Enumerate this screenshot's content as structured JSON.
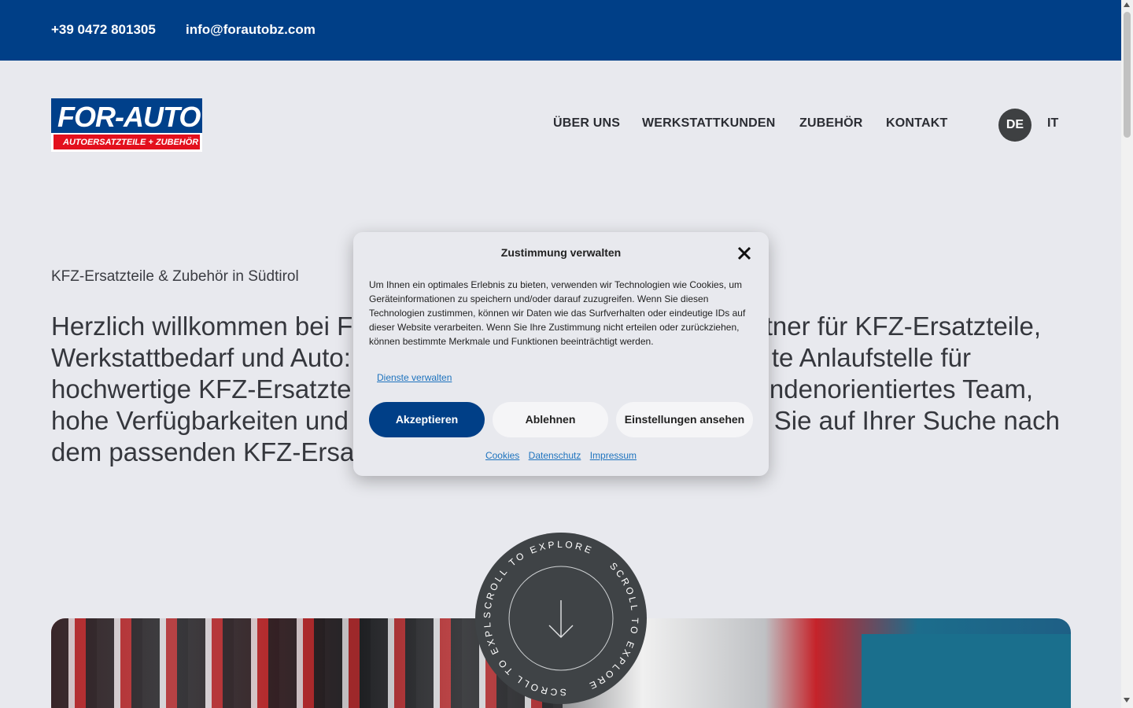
{
  "topbar": {
    "phone": "+39 0472 801305",
    "email": "info@forautobz.com",
    "bg_color": "#003f87"
  },
  "logo": {
    "brand": "FOR-AUTO",
    "tagline": "AUTOERSATZTEILE + ZUBEHÖR"
  },
  "nav": {
    "items": [
      {
        "label": "ÜBER UNS"
      },
      {
        "label": "WERKSTATTKUNDEN"
      },
      {
        "label": "ZUBEHÖR"
      },
      {
        "label": "KONTAKT"
      }
    ],
    "lang_active": "DE",
    "lang_other": "IT"
  },
  "hero": {
    "eyebrow": "KFZ-Ersatzteile & Zubehör in Südtirol",
    "line1_left": "Herzlich willkommen bei F",
    "line1_right": "tner für KFZ-Ersatzteile,",
    "line2_left": "Werkstattbedarf und Auto:",
    "line2_right": "te Anlaufstelle für",
    "line3_left": "hochwertige KFZ-Ersatzte",
    "line3_right": "ndenorientiertes Team,",
    "line4_left": "hohe Verfügbarkeiten und",
    "line4_right": "Sie auf Ihrer Suche nach",
    "line5_left": "dem passenden KFZ-Ersa"
  },
  "scroll_badge": {
    "text": "SCROLL TO EXPLORE",
    "icon": "arrow-down-icon"
  },
  "consent": {
    "title": "Zustimmung verwalten",
    "close_icon": "close-icon",
    "body": "Um Ihnen ein optimales Erlebnis zu bieten, verwenden wir Technologien wie Cookies, um Geräteinformationen zu speichern und/oder darauf zuzugreifen. Wenn Sie diesen Technologien zustimmen, können wir Daten wie das Surfverhalten oder eindeutige IDs auf dieser Website verarbeiten. Wenn Sie Ihre Zustimmung nicht erteilen oder zurückziehen, können bestimmte Merkmale und Funktionen beeinträchtigt werden.",
    "manage_link": "Dienste verwalten",
    "accept": "Akzeptieren",
    "deny": "Ablehnen",
    "preferences": "Einstellungen ansehen",
    "footer_links": [
      "Cookies",
      "Datenschutz",
      "Impressum"
    ],
    "accent_color": "#003f87",
    "link_color": "#1e73be"
  }
}
